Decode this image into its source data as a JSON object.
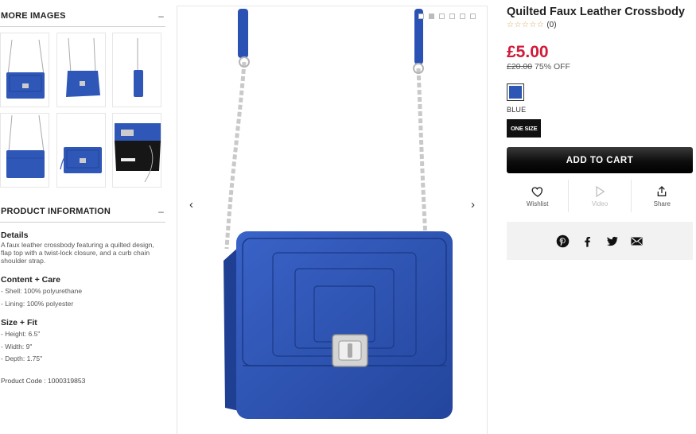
{
  "left": {
    "more_images_label": "MORE IMAGES",
    "more_images_toggle": "–",
    "product_info_label": "PRODUCT INFORMATION",
    "product_info_toggle": "–",
    "details_heading": "Details",
    "details_text": "A faux leather crossbody featuring a quilted design, flap top with a twist-lock closure, and a curb chain shoulder strap.",
    "care_heading": "Content + Care",
    "care_items": [
      "- Shell: 100% polyurethane",
      "- Lining: 100% polyester"
    ],
    "fit_heading": "Size + Fit",
    "fit_items": [
      "- Height: 6.5\"",
      "- Width: 9\"",
      "- Depth: 1.75\""
    ],
    "product_code": "Product Code : 1000319853"
  },
  "gallery": {
    "prev_arrow": "‹",
    "next_arrow": "›",
    "active_dot": 2
  },
  "product": {
    "title": "Quilted Faux Leather Crossbody",
    "stars": "☆☆☆☆☆",
    "review_count": "(0)",
    "price": "£5.00",
    "old_price": "£20.00",
    "discount": "75% OFF",
    "color_name": "BLUE",
    "color_hex": "#2e56b4",
    "size": "ONE SIZE",
    "add_to_cart": "ADD TO CART"
  },
  "actions": {
    "wishlist": "Wishlist",
    "video": "Video",
    "share": "Share"
  },
  "social": {
    "icons": [
      "pinterest-icon",
      "facebook-icon",
      "twitter-icon",
      "email-icon"
    ]
  }
}
